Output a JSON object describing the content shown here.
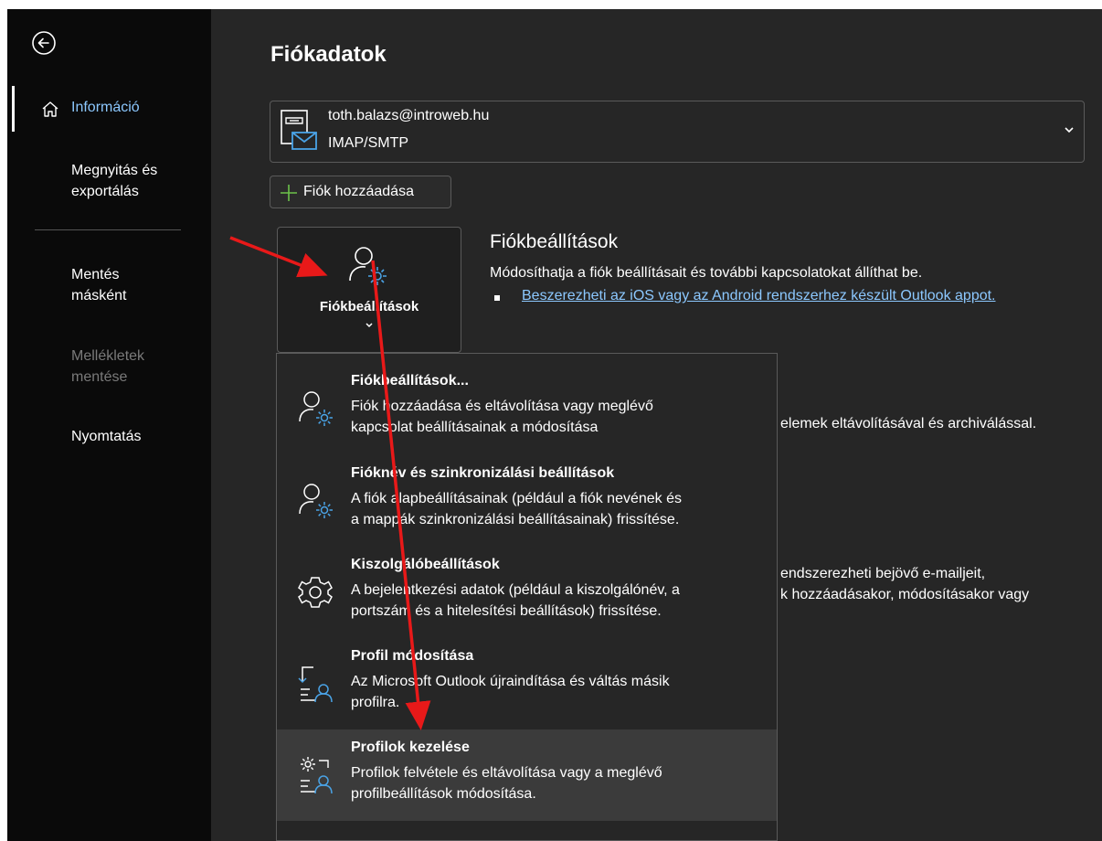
{
  "sidebar": {
    "nav": {
      "info": "Információ",
      "open_export_line1": "Megnyitás és",
      "open_export_line2": "exportálás",
      "save_as_line1": "Mentés",
      "save_as_line2": "másként",
      "save_attachments_line1": "Mellékletek",
      "save_attachments_line2": "mentése",
      "print": "Nyomtatás"
    }
  },
  "main": {
    "title": "Fiókadatok",
    "account": {
      "email": "toth.balazs@introweb.hu",
      "type": "IMAP/SMTP"
    },
    "add_account_label": "Fiók hozzáadása",
    "tile_label": "Fiókbeállítások",
    "section": {
      "heading": "Fiókbeállítások",
      "description": "Módosíthatja a fiók beállításait és további kapcsolatokat állíthat be.",
      "link": "Beszerezheti az iOS vagy az Android rendszerhez készült Outlook appot."
    },
    "background_fragments": {
      "line1": "elemek eltávolításával és archiválással.",
      "line2": "endszerezheti bejövő e-mailjeit,",
      "line3": "k hozzáadásakor, módosításakor vagy"
    }
  },
  "dropdown": {
    "items": [
      {
        "title": "Fiókbeállítások...",
        "desc_line1": "Fiók hozzáadása és eltávolítása vagy meglévő",
        "desc_line2": "kapcsolat beállításainak a módosítása",
        "icon": "person-gear-icon"
      },
      {
        "title": "Fióknév és szinkronizálási beállítások",
        "desc_line1": "A fiók alapbeállításainak (például a fiók nevének és",
        "desc_line2": "a mappák szinkronizálási beállításainak) frissítése.",
        "icon": "person-gear-icon"
      },
      {
        "title": "Kiszolgálóbeállítások",
        "desc_line1": "A bejelentkezési adatok (például a kiszolgálónév, a",
        "desc_line2": "portszám és a hitelesítési beállítások) frissítése.",
        "icon": "gear-icon"
      },
      {
        "title": "Profil módosítása",
        "desc_line1": "Az Microsoft Outlook újraindítása és váltás másik",
        "desc_line2": "profilra.",
        "icon": "switch-profile-icon"
      },
      {
        "title": "Profilok kezelése",
        "desc_line1": "Profilok felvétele és eltávolítása vagy a meglévő",
        "desc_line2": "profilbeállítások módosítása.",
        "icon": "manage-profiles-icon"
      }
    ]
  },
  "colors": {
    "sidebar_bg": "#0a0a0a",
    "content_bg": "#262626",
    "accent_blue": "#8cc8ff",
    "icon_blue": "#4aa3e6",
    "arrow_red": "#e81919"
  }
}
